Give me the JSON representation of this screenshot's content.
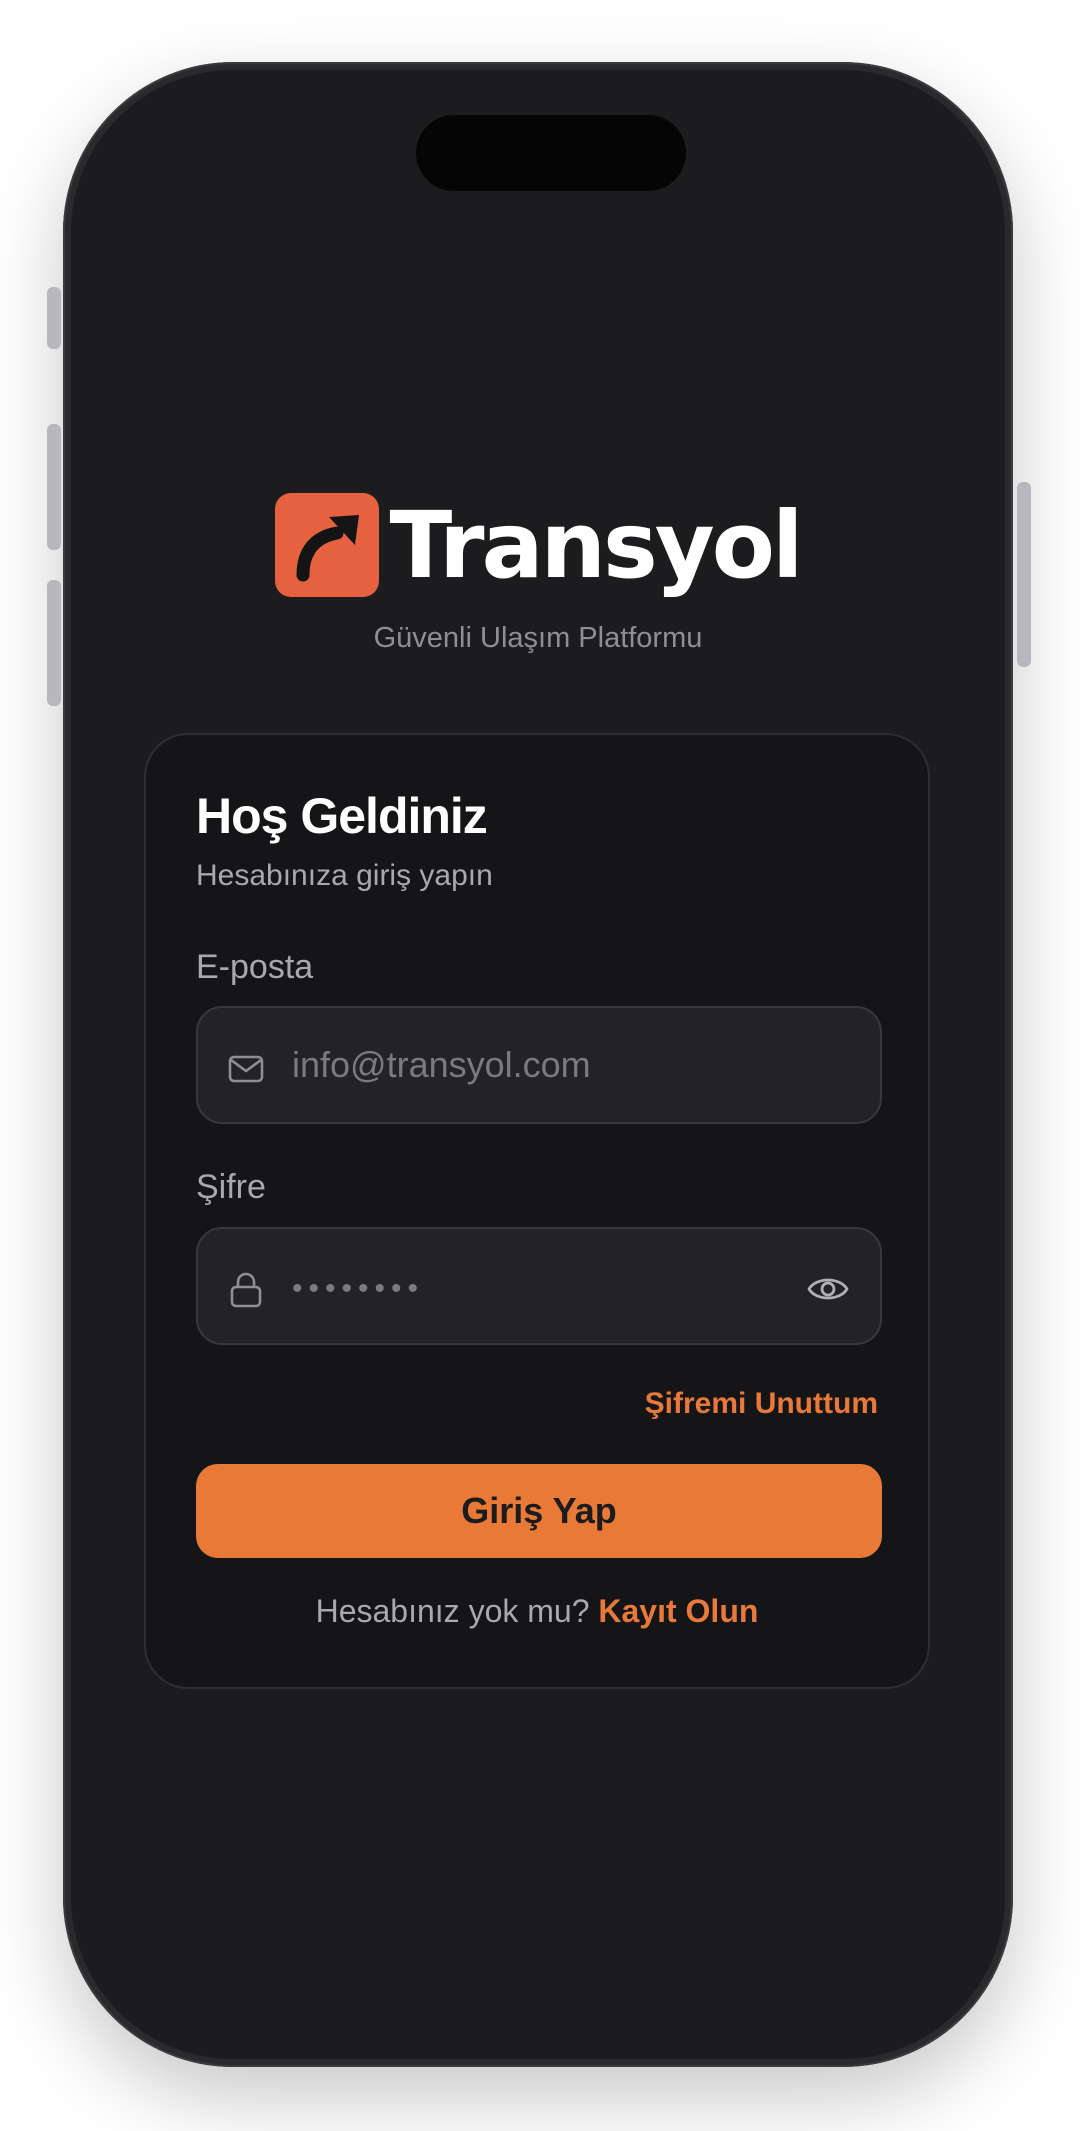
{
  "brand": {
    "name": "Transyol",
    "tagline": "Güvenli Ulaşım Platformu",
    "logo_color": "#e5613f"
  },
  "login_card": {
    "title": "Hoş Geldiniz",
    "subtitle": "Hesabınıza giriş yapın",
    "email": {
      "label": "E-posta",
      "placeholder": "info@transyol.com",
      "value": "",
      "icon": "mail-icon"
    },
    "password": {
      "label": "Şifre",
      "placeholder": "••••••••",
      "value": "",
      "icon": "lock-icon",
      "toggle_icon": "eye-icon"
    },
    "forgot_password": "Şifremi Unuttum",
    "login_button": "Giriş Yap",
    "signup_prompt": "Hesabınız yok mu?",
    "signup_link": "Kayıt Olun"
  },
  "colors": {
    "accent": "#e87936",
    "background": "#1c1c1e",
    "card": "#151517"
  }
}
